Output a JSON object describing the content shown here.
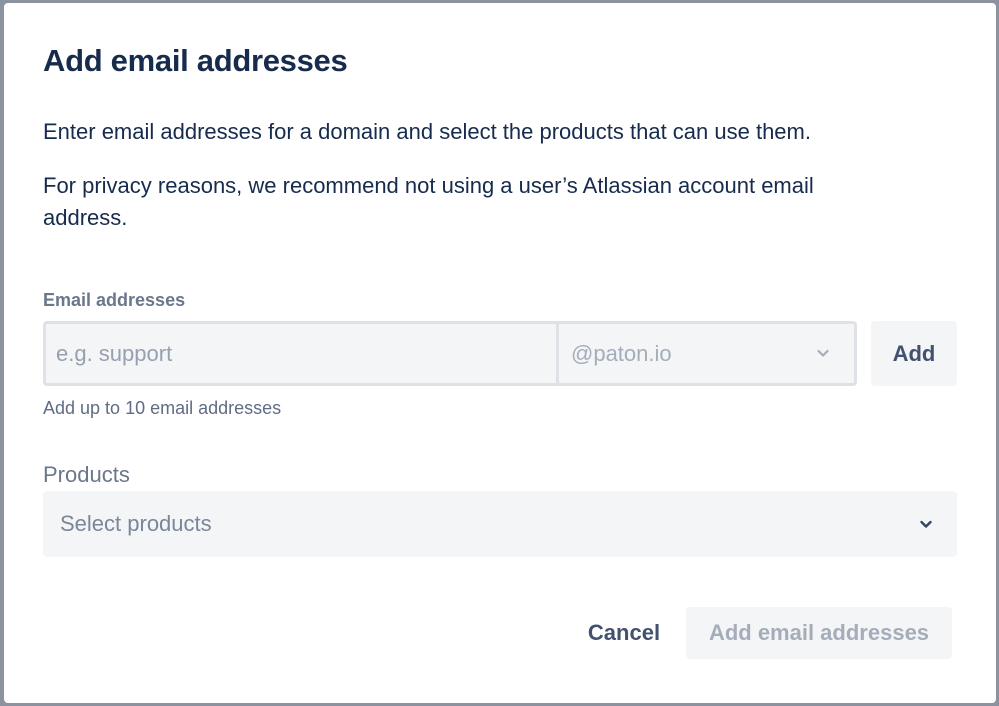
{
  "dialog": {
    "title": "Add email addresses",
    "description_1": "Enter email addresses for a domain and select the products that can use them.",
    "description_2": "For privacy reasons, we recommend not using a user’s Atlassian account email address."
  },
  "email": {
    "label": "Email addresses",
    "placeholder": "e.g. support",
    "value": "",
    "domain": "@paton.io",
    "add_label": "Add",
    "helper": "Add up to 10 email addresses"
  },
  "products": {
    "label": "Products",
    "placeholder": "Select products"
  },
  "footer": {
    "cancel_label": "Cancel",
    "submit_label": "Add email addresses"
  },
  "icons": {
    "domain_chevron": "chevron-down-icon",
    "products_chevron": "chevron-down-icon"
  },
  "colors": {
    "text_primary": "#172b4d",
    "text_subtle": "#6b778c",
    "field_background": "#f4f5f7",
    "field_border": "#dfe1e6",
    "disabled_text": "#a5adba"
  }
}
